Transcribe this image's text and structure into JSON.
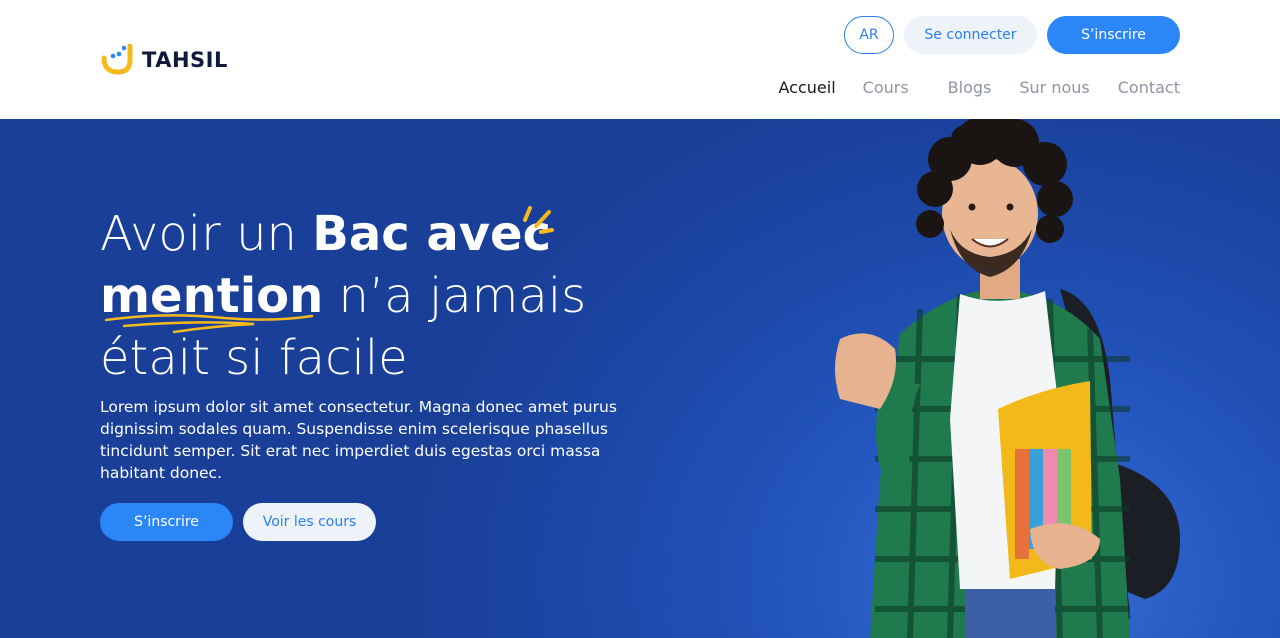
{
  "brand": {
    "name": "TAHSIL",
    "colors": {
      "primary": "#2b86f7",
      "accent": "#f6b91c",
      "hero_bg": "#1f4aa8",
      "logo_text": "#0f1a3a"
    }
  },
  "header": {
    "lang_label": "AR",
    "login_label": "Se connecter",
    "signup_label": "S’inscrire",
    "nav": [
      {
        "label": "Accueil",
        "active": true
      },
      {
        "label": "Cours",
        "active": false
      },
      {
        "label": "Blogs",
        "active": false
      },
      {
        "label": "Sur nous",
        "active": false
      },
      {
        "label": "Contact",
        "active": false
      }
    ]
  },
  "hero": {
    "headline_part1": "Avoir un ",
    "headline_bold1": "Bac avec",
    "headline_bold2": "mention",
    "headline_part2": " n’a jamais",
    "headline_part3": "était si facile",
    "lead": "Lorem ipsum dolor sit amet consectetur. Magna donec amet purus dignissim sodales quam. Suspendisse enim scelerisque phasellus tincidunt semper. Sit erat nec imperdiet duis egestas orci massa habitant donec.",
    "cta_primary": "S’inscrire",
    "cta_secondary": "Voir les cours",
    "image_subject": "smiling-student-with-books"
  }
}
